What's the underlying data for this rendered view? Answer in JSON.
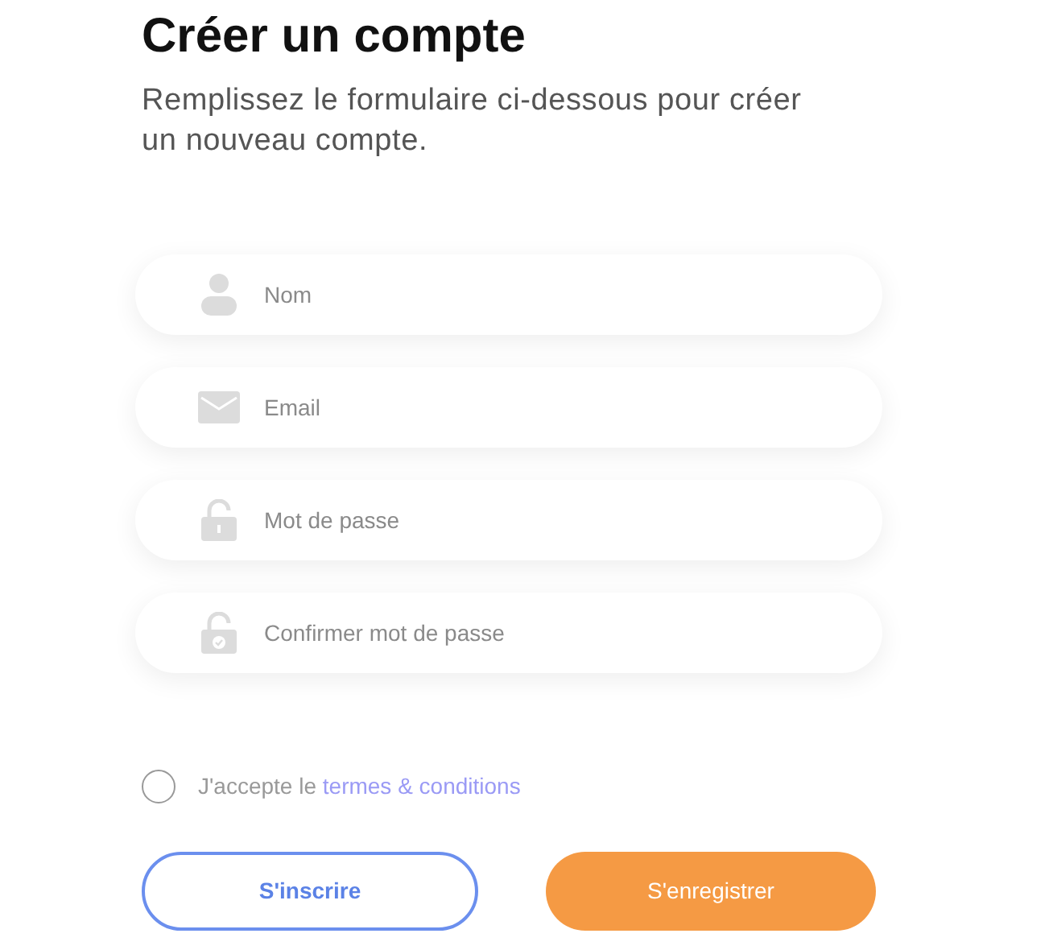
{
  "title": "Créer un compte",
  "subtitle": "Remplissez le formulaire ci-dessous pour créer un nouveau compte.",
  "fields": [
    {
      "kind": "person",
      "placeholder": "Nom"
    },
    {
      "kind": "mail",
      "placeholder": "Email"
    },
    {
      "kind": "lock",
      "placeholder": "Mot de passe"
    },
    {
      "kind": "lock-check",
      "placeholder": "Confirmer mot de passe"
    }
  ],
  "terms": {
    "checked": false,
    "text": "J'accepte le",
    "link": "termes & conditions"
  },
  "buttons": [
    {
      "kind": "outline",
      "label": "S'inscrire"
    },
    {
      "kind": "filled",
      "label": "S'enregistrer"
    }
  ]
}
